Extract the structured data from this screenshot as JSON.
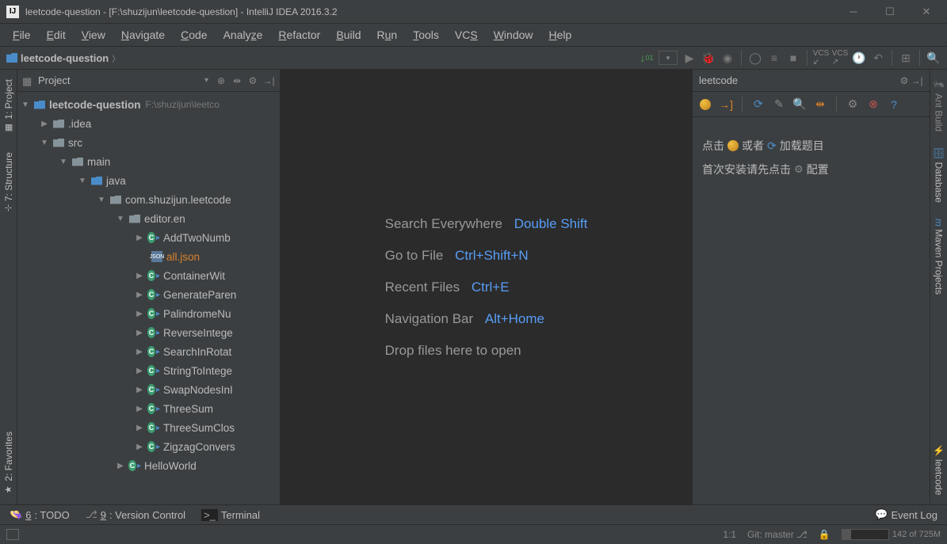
{
  "titlebar": {
    "text": "leetcode-question - [F:\\shuzijun\\leetcode-question] - IntelliJ IDEA 2016.3.2"
  },
  "menubar": [
    "File",
    "Edit",
    "View",
    "Navigate",
    "Code",
    "Analyze",
    "Refactor",
    "Build",
    "Run",
    "Tools",
    "VCS",
    "Window",
    "Help"
  ],
  "breadcrumb": {
    "project": "leetcode-question"
  },
  "project_panel": {
    "title": "Project",
    "root": {
      "name": "leetcode-question",
      "path": "F:\\shuzijun\\leetco"
    },
    "nodes": [
      ".idea",
      "src",
      "main",
      "java",
      "com.shuzijun.leetcode",
      "editor.en"
    ],
    "files": [
      "AddTwoNumb",
      "all.json",
      "ContainerWit",
      "GenerateParen",
      "PalindromeNu",
      "ReverseIntege",
      "SearchInRotat",
      "StringToIntege",
      "SwapNodesInI",
      "ThreeSum",
      "ThreeSumClos",
      "ZigzagConvers",
      "HelloWorld"
    ]
  },
  "editor_tips": [
    {
      "action": "Search Everywhere",
      "shortcut": "Double Shift"
    },
    {
      "action": "Go to File",
      "shortcut": "Ctrl+Shift+N"
    },
    {
      "action": "Recent Files",
      "shortcut": "Ctrl+E"
    },
    {
      "action": "Navigation Bar",
      "shortcut": "Alt+Home"
    },
    {
      "action": "Drop files here to open",
      "shortcut": ""
    }
  ],
  "leetcode_panel": {
    "title": "leetcode",
    "line1_a": "点击",
    "line1_b": "或者",
    "line1_c": "加载题目",
    "line2_a": "首次安装请先点击",
    "line2_b": "配置"
  },
  "left_tabs": [
    "1: Project",
    "7: Structure",
    "2: Favorites"
  ],
  "right_tabs": [
    "Ant Build",
    "Database",
    "Maven Projects",
    "leetcode"
  ],
  "bottom_tabs": {
    "todo": "6: TODO",
    "vcs": "9: Version Control",
    "terminal": "Terminal",
    "eventlog": "Event Log"
  },
  "statusbar": {
    "pos": "1:1",
    "branch": "Git: master",
    "mem": "142 of 725M"
  }
}
